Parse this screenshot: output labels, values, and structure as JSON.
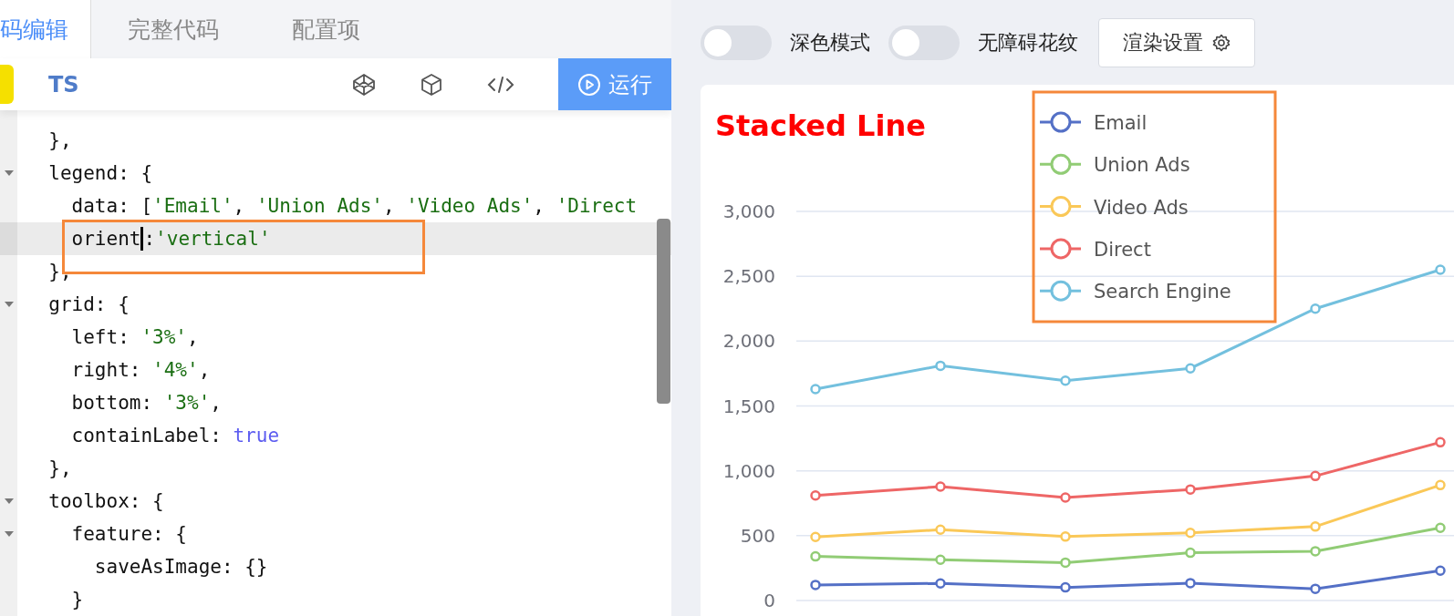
{
  "editor": {
    "tabs": [
      {
        "label": "码编辑",
        "selected": true
      },
      {
        "label": "完整代码",
        "selected": false
      },
      {
        "label": "配置项",
        "selected": false
      }
    ],
    "language": "TS",
    "run_button": "运行",
    "lines": [
      {
        "foldable": false,
        "active": false,
        "segments": [
          {
            "kind": "plain",
            "text": "  },"
          }
        ]
      },
      {
        "foldable": true,
        "active": false,
        "segments": [
          {
            "kind": "plain",
            "text": "  legend: {"
          }
        ]
      },
      {
        "foldable": false,
        "active": false,
        "segments": [
          {
            "kind": "plain",
            "text": "    data: ["
          },
          {
            "kind": "string",
            "text": "'Email'"
          },
          {
            "kind": "plain",
            "text": ", "
          },
          {
            "kind": "string",
            "text": "'Union Ads'"
          },
          {
            "kind": "plain",
            "text": ", "
          },
          {
            "kind": "string",
            "text": "'Video Ads'"
          },
          {
            "kind": "plain",
            "text": ", "
          },
          {
            "kind": "string",
            "text": "'Direct"
          }
        ]
      },
      {
        "foldable": false,
        "active": true,
        "segments": [
          {
            "kind": "plain",
            "text": "    orient"
          },
          {
            "kind": "caret"
          },
          {
            "kind": "plain",
            "text": ":"
          },
          {
            "kind": "string",
            "text": "'vertical'"
          }
        ]
      },
      {
        "foldable": false,
        "active": false,
        "segments": [
          {
            "kind": "plain",
            "text": "  },"
          }
        ]
      },
      {
        "foldable": true,
        "active": false,
        "segments": [
          {
            "kind": "plain",
            "text": "  grid: {"
          }
        ]
      },
      {
        "foldable": false,
        "active": false,
        "segments": [
          {
            "kind": "plain",
            "text": "    left: "
          },
          {
            "kind": "string",
            "text": "'3%'"
          },
          {
            "kind": "plain",
            "text": ","
          }
        ]
      },
      {
        "foldable": false,
        "active": false,
        "segments": [
          {
            "kind": "plain",
            "text": "    right: "
          },
          {
            "kind": "string",
            "text": "'4%'"
          },
          {
            "kind": "plain",
            "text": ","
          }
        ]
      },
      {
        "foldable": false,
        "active": false,
        "segments": [
          {
            "kind": "plain",
            "text": "    bottom: "
          },
          {
            "kind": "string",
            "text": "'3%'"
          },
          {
            "kind": "plain",
            "text": ","
          }
        ]
      },
      {
        "foldable": false,
        "active": false,
        "segments": [
          {
            "kind": "plain",
            "text": "    containLabel: "
          },
          {
            "kind": "keyword",
            "text": "true"
          }
        ]
      },
      {
        "foldable": false,
        "active": false,
        "segments": [
          {
            "kind": "plain",
            "text": "  },"
          }
        ]
      },
      {
        "foldable": true,
        "active": false,
        "segments": [
          {
            "kind": "plain",
            "text": "  toolbox: {"
          }
        ]
      },
      {
        "foldable": true,
        "active": false,
        "segments": [
          {
            "kind": "plain",
            "text": "    feature: {"
          }
        ]
      },
      {
        "foldable": false,
        "active": false,
        "segments": [
          {
            "kind": "plain",
            "text": "      saveAsImage: {}"
          }
        ]
      },
      {
        "foldable": false,
        "active": false,
        "segments": [
          {
            "kind": "plain",
            "text": "    }"
          }
        ]
      }
    ]
  },
  "preview": {
    "toggles": [
      {
        "label": "深色模式",
        "on": false
      },
      {
        "label": "无障碍花纹",
        "on": false
      }
    ],
    "render_button": "渲染设置",
    "chart_data": {
      "type": "line",
      "title": "Stacked Line",
      "grid": true,
      "legend": true,
      "ylim": [
        0,
        3000
      ],
      "yticks": [
        {
          "value": 0,
          "label": "0"
        },
        {
          "value": 500,
          "label": "500"
        },
        {
          "value": 1000,
          "label": "1,000"
        },
        {
          "value": 1500,
          "label": "1,500"
        },
        {
          "value": 2000,
          "label": "2,000"
        },
        {
          "value": 2500,
          "label": "2,500"
        },
        {
          "value": 3000,
          "label": "3,000"
        }
      ],
      "series": [
        {
          "name": "Email",
          "color": "#5470c6",
          "marker": "circle",
          "values": [
            120,
            132,
            101,
            134,
            90,
            230
          ]
        },
        {
          "name": "Union Ads",
          "color": "#91cc75",
          "marker": "circle",
          "values": [
            340,
            314,
            292,
            368,
            380,
            560
          ]
        },
        {
          "name": "Video Ads",
          "color": "#fac858",
          "marker": "circle",
          "values": [
            490,
            546,
            493,
            522,
            570,
            890
          ]
        },
        {
          "name": "Direct",
          "color": "#ee6666",
          "marker": "circle",
          "values": [
            810,
            878,
            794,
            856,
            960,
            1220
          ]
        },
        {
          "name": "Search Engine",
          "color": "#73c0de",
          "marker": "circle",
          "values": [
            1630,
            1810,
            1695,
            1790,
            2250,
            2550
          ]
        }
      ]
    }
  }
}
